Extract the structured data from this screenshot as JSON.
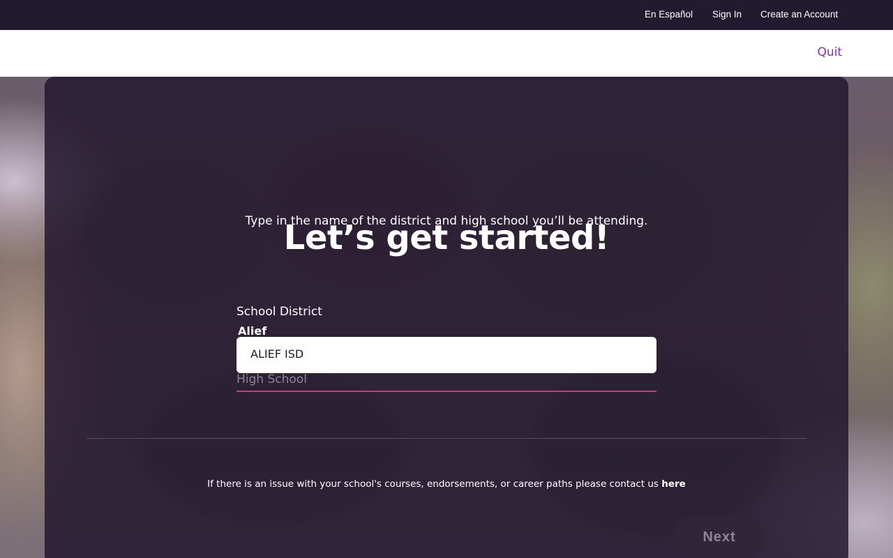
{
  "topbar": {
    "spanish_label": "En Español",
    "signin_label": "Sign In",
    "create_account_label": "Create an Account"
  },
  "header": {
    "quit_label": "Quit"
  },
  "form": {
    "title": "Let’s get started!",
    "subtitle": "Type in the name of the district and high school you’ll be attending.",
    "district_label": "School District",
    "district_value": "Alief",
    "district_suggestion": "ALIEF ISD",
    "high_school_placeholder": "High School",
    "high_school_value": "",
    "contact_text": "If there is an issue with your school's courses, endorsements, or career paths please contact us ",
    "contact_link": "here",
    "next_label": "Next"
  },
  "colors": {
    "accent": "#8a2bbf",
    "input_underline": "#c2407f",
    "topbar": "#221a2f"
  }
}
